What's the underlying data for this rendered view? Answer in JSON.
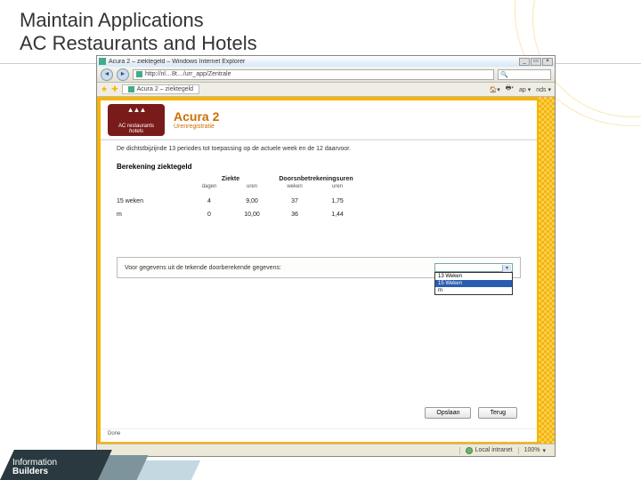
{
  "slide": {
    "title_line1": "Maintain Applications",
    "title_line2": "AC Restaurants and Hotels",
    "footer_brand_top": "Information",
    "footer_brand_bottom": "Builders"
  },
  "browser": {
    "window_title": "Acura 2 – ziektegeld – Windows Internet Explorer",
    "address": "http://nl…8t…/urr_app/Zentrale",
    "tab_label": "Acura 2 – ziektegeld",
    "toolbar_right": {
      "page": "ap ▾",
      "tools": "nds ▾"
    },
    "win_min": "_",
    "win_max": "▭",
    "win_close": "×",
    "status": {
      "zone": "Local intranet",
      "zoom": "100%"
    }
  },
  "app": {
    "logo": {
      "line1": "AC restaurants",
      "line2": "hotels"
    },
    "title": "Acura 2",
    "subtitle": "Urenregistratie",
    "lead_text": "De dichtstbijzijnde 13 periodes tot toepassing op de actuele week en de 12 daarvoor.",
    "section_title": "Berekening ziektegeld",
    "table": {
      "group1": "Ziekte",
      "group2": "Doorsnbetrekeningsuren",
      "sub1": "dagen",
      "sub2": "uren",
      "sub3": "weken",
      "sub4": "uren",
      "rows": [
        {
          "label": "15 weken",
          "c1": "4",
          "c2": "9,00",
          "c3": "37",
          "c4": "1,75"
        },
        {
          "label": " m",
          "c1": "0",
          "c2": "10,00",
          "c3": "36",
          "c4": "1,44"
        }
      ]
    },
    "panel": {
      "label": "Voor gegevens uit de tekende doorberekende gegevens:",
      "options": [
        "13 Weken",
        "15 Weken",
        "m"
      ],
      "selected_index": 1
    },
    "buttons": {
      "save": "Opslaan",
      "back": "Terug"
    },
    "footer_text": "Done"
  }
}
